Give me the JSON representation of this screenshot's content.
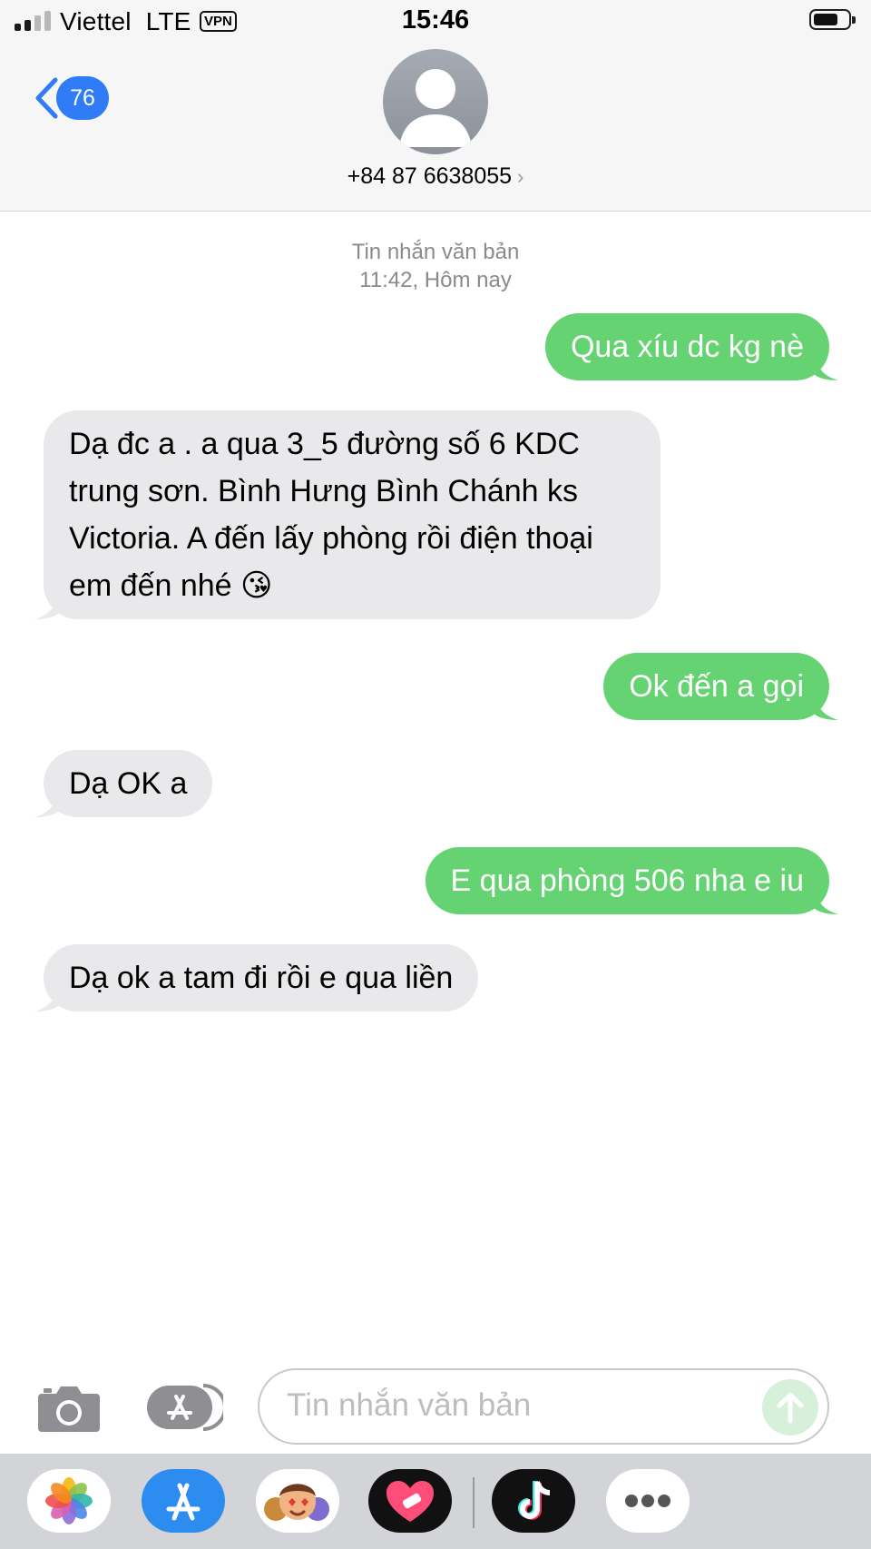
{
  "status_bar": {
    "carrier": "Viettel",
    "network": "LTE",
    "vpn": "VPN",
    "time": "15:46"
  },
  "header": {
    "back_badge": "76",
    "contact": "+84 87 6638055"
  },
  "thread": {
    "stamp_line1": "Tin nhắn văn bản",
    "stamp_line2": "11:42, Hôm nay",
    "messages": [
      {
        "dir": "out",
        "text": "Qua xíu dc kg nè"
      },
      {
        "dir": "in",
        "text": "Dạ đc a . a qua 3_5 đường số 6 KDC trung sơn. Bình Hưng Bình Chánh ks Victoria. A đến lấy phòng rồi điện thoại em đến nhé 😘"
      },
      {
        "dir": "out",
        "text": "Ok đến a gọi"
      },
      {
        "dir": "in",
        "text": "Dạ OK a"
      },
      {
        "dir": "out",
        "text": "E qua phòng 506 nha e iu"
      },
      {
        "dir": "in",
        "text": "Dạ ok a tam đi rồi e qua liền"
      }
    ]
  },
  "composer": {
    "placeholder": "Tin nhắn văn bản"
  },
  "app_strip": [
    {
      "icon": "photos-icon"
    },
    {
      "icon": "app-store-icon"
    },
    {
      "icon": "memoji-icon"
    },
    {
      "icon": "heart-app-icon"
    },
    {
      "icon": "tiktok-icon"
    },
    {
      "icon": "more-apps-icon"
    }
  ],
  "colors": {
    "outgoing_bubble": "#65d372",
    "incoming_bubble": "#e9e9eb",
    "accent": "#2f7cf6"
  }
}
